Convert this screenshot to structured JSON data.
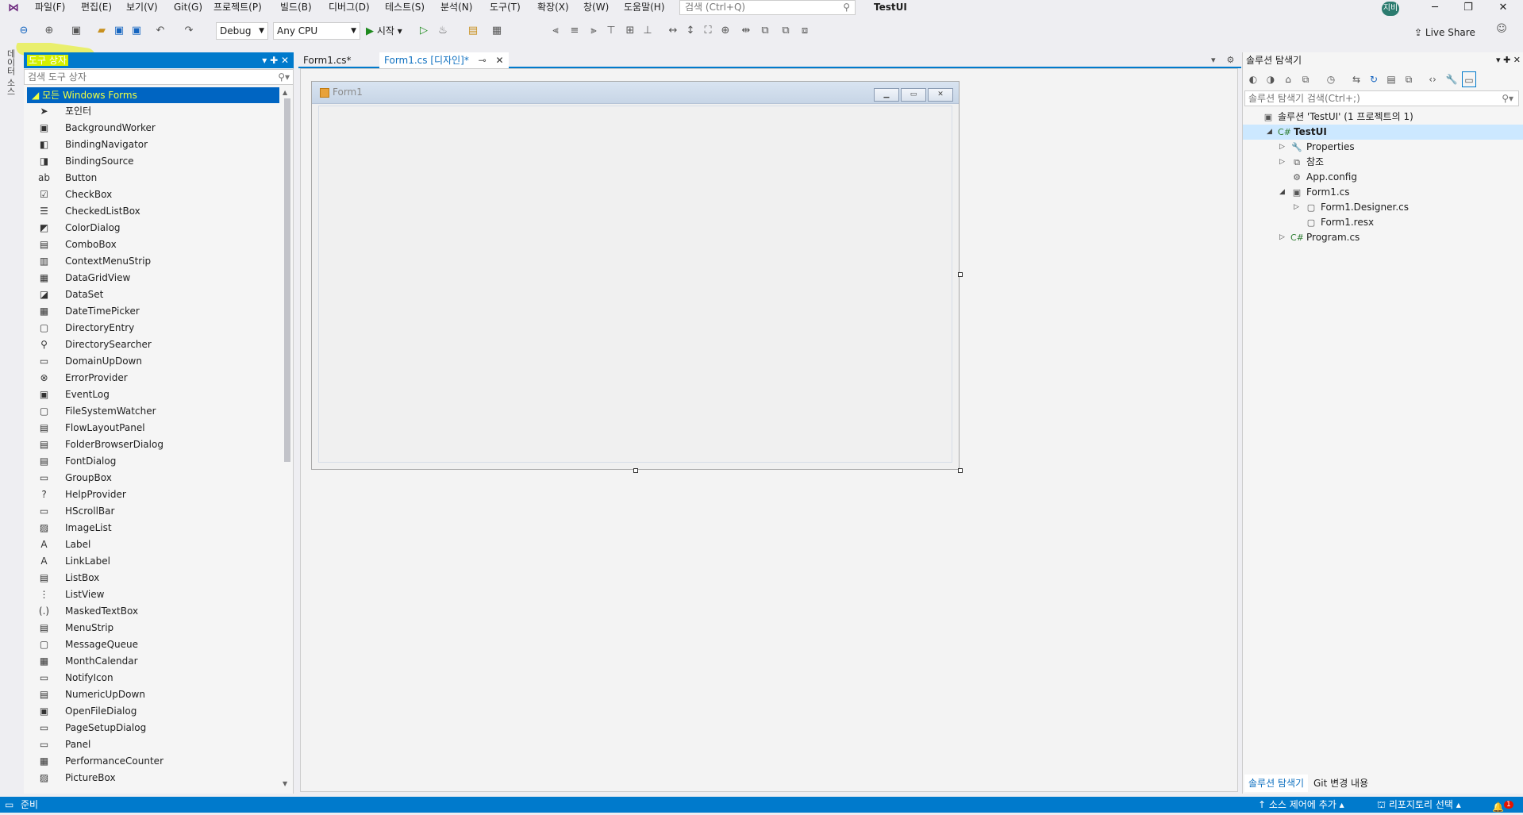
{
  "menubar": {
    "items": [
      "파일(F)",
      "편집(E)",
      "보기(V)",
      "Git(G)",
      "프로젝트(P)",
      "빌드(B)",
      "디버그(D)",
      "테스트(S)",
      "분석(N)",
      "도구(T)",
      "확장(X)",
      "창(W)",
      "도움말(H)"
    ],
    "search_placeholder": "검색 (Ctrl+Q)",
    "app_title": "TestUI",
    "avatar_initials": "지비",
    "minimize": "─",
    "restore": "❐",
    "close": "✕"
  },
  "toolbar": {
    "config": "Debug",
    "platform": "Any CPU",
    "start_label": "시작",
    "live_share": "Live Share"
  },
  "sidetab": {
    "label": "데이터 소스"
  },
  "toolbox": {
    "title": "도구 상자",
    "search_placeholder": "검색 도구 상자",
    "group": "모든 Windows Forms",
    "items": [
      "포인터",
      "BackgroundWorker",
      "BindingNavigator",
      "BindingSource",
      "Button",
      "CheckBox",
      "CheckedListBox",
      "ColorDialog",
      "ComboBox",
      "ContextMenuStrip",
      "DataGridView",
      "DataSet",
      "DateTimePicker",
      "DirectoryEntry",
      "DirectorySearcher",
      "DomainUpDown",
      "ErrorProvider",
      "EventLog",
      "FileSystemWatcher",
      "FlowLayoutPanel",
      "FolderBrowserDialog",
      "FontDialog",
      "GroupBox",
      "HelpProvider",
      "HScrollBar",
      "ImageList",
      "Label",
      "LinkLabel",
      "ListBox",
      "ListView",
      "MaskedTextBox",
      "MenuStrip",
      "MessageQueue",
      "MonthCalendar",
      "NotifyIcon",
      "NumericUpDown",
      "OpenFileDialog",
      "PageSetupDialog",
      "Panel",
      "PerformanceCounter",
      "PictureBox"
    ],
    "icons": [
      "➤",
      "▣",
      "◧",
      "◨",
      "ab",
      "☑",
      "☰",
      "◩",
      "▤",
      "▥",
      "▦",
      "◪",
      "▦",
      "▢",
      "⚲",
      "▭",
      "⊗",
      "▣",
      "▢",
      "▤",
      "▤",
      "▤",
      "▭",
      "?",
      "▭",
      "▨",
      "A",
      "A",
      "▤",
      "⋮",
      "(.)",
      "▤",
      "▢",
      "▦",
      "▭",
      "▤",
      "▣",
      "▭",
      "▭",
      "▦",
      "▨"
    ]
  },
  "doctabs": {
    "tab1": "Form1.cs*",
    "tab2": "Form1.cs [디자인]*"
  },
  "form": {
    "title": "Form1"
  },
  "solution_explorer": {
    "title": "솔루션 탐색기",
    "search_placeholder": "솔루션 탐색기 검색(Ctrl+;)",
    "tree": [
      {
        "label": "솔루션 'TestUI' (1 프로젝트의 1)",
        "icon": "▣",
        "level": 0
      },
      {
        "label": "TestUI",
        "icon": "C#",
        "level": 1,
        "bold": true,
        "expanded": true
      },
      {
        "label": "Properties",
        "icon": "🔧",
        "level": 2,
        "collapsed": true
      },
      {
        "label": "참조",
        "icon": "⧉",
        "level": 2,
        "collapsed": true
      },
      {
        "label": "App.config",
        "icon": "⚙",
        "level": 2
      },
      {
        "label": "Form1.cs",
        "icon": "▣",
        "level": 2,
        "expanded": true
      },
      {
        "label": "Form1.Designer.cs",
        "icon": "▢",
        "level": 3,
        "collapsed": true
      },
      {
        "label": "Form1.resx",
        "icon": "▢",
        "level": 3
      },
      {
        "label": "Program.cs",
        "icon": "C#",
        "level": 2,
        "collapsed": true
      }
    ],
    "bottom_tabs": [
      "솔루션 탐색기",
      "Git 변경 내용"
    ]
  },
  "status": {
    "ready": "준비",
    "source_control": "소스 제어에 추가",
    "repository": "리포지토리 선택",
    "notifications": "1"
  },
  "colors": {
    "accent": "#007acc",
    "selection": "#cce8ff"
  }
}
